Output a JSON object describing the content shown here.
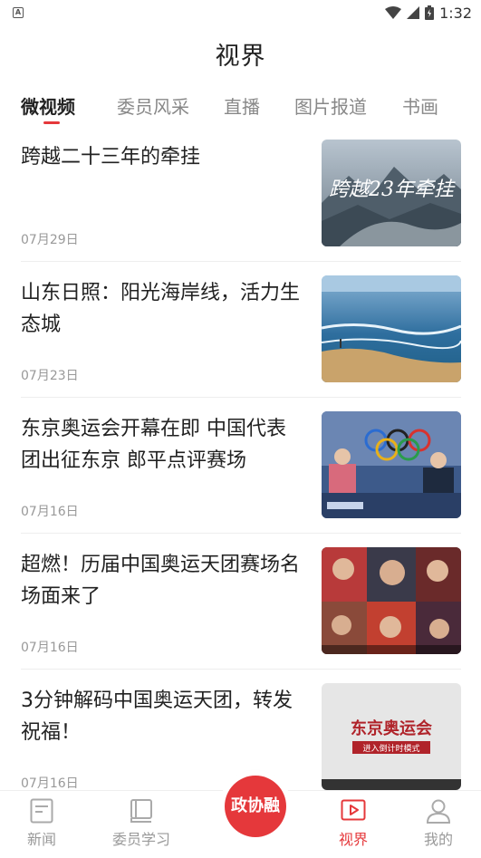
{
  "status_bar": {
    "time": "1:32",
    "left_badge": "A",
    "icons": [
      "wifi-icon",
      "signal-icon",
      "battery-icon"
    ]
  },
  "header": {
    "title": "视界"
  },
  "tabs": [
    {
      "label": "微视频",
      "active": true
    },
    {
      "label": "委员风采",
      "active": false
    },
    {
      "label": "直播",
      "active": false
    },
    {
      "label": "图片报道",
      "active": false
    },
    {
      "label": "书画",
      "active": false
    }
  ],
  "feed": [
    {
      "title": "跨越二十三年的牵挂",
      "date": "07月29日",
      "thumb_text": "跨越23年牵挂"
    },
    {
      "title": "山东日照：阳光海岸线，活力生态城",
      "date": "07月23日",
      "thumb_text": ""
    },
    {
      "title": "东京奥运会开幕在即 中国代表团出征东京 郎平点评赛场",
      "date": "07月16日",
      "thumb_text": ""
    },
    {
      "title": "超燃！历届中国奥运天团赛场名场面来了",
      "date": "07月16日",
      "thumb_text": ""
    },
    {
      "title": "3分钟解码中国奥运天团，转发祝福！",
      "date": "07月16日",
      "thumb_text": "东京奥运会",
      "thumb_subtext": "进入倒计时模式"
    }
  ],
  "bottom_nav": {
    "items": [
      {
        "label": "新闻",
        "icon": "news-icon",
        "active": false
      },
      {
        "label": "委员学习",
        "icon": "book-icon",
        "active": false
      },
      {
        "label": "视界",
        "icon": "video-icon",
        "active": true
      },
      {
        "label": "我的",
        "icon": "profile-icon",
        "active": false
      }
    ],
    "center_button": "政协融"
  },
  "colors": {
    "accent": "#e5383b",
    "text": "#222222",
    "muted": "#999999"
  }
}
